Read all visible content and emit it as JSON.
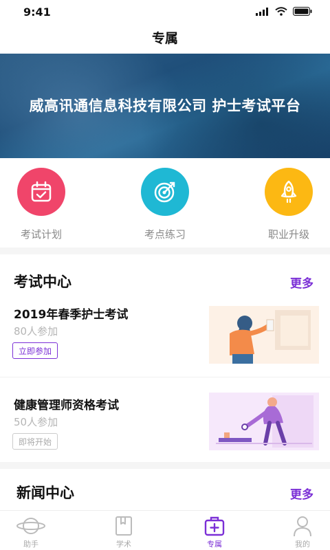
{
  "status": {
    "time": "9:41"
  },
  "nav": {
    "title": "专属"
  },
  "banner": {
    "text": "威高讯通信息科技有限公司 护士考试平台"
  },
  "quick": [
    {
      "label": "考试计划",
      "icon": "calendar-check-icon",
      "color": "#f0456a"
    },
    {
      "label": "考点练习",
      "icon": "target-icon",
      "color": "#1fb8d4"
    },
    {
      "label": "职业升级",
      "icon": "rocket-icon",
      "color": "#fcb813"
    }
  ],
  "exam_center": {
    "title": "考试中心",
    "more": "更多",
    "items": [
      {
        "title": "2019年春季护士考试",
        "count": "80人参加",
        "button": "立即参加",
        "state": "active"
      },
      {
        "title": "健康管理师资格考试",
        "count": "50人参加",
        "button": "即将开始",
        "state": "disabled"
      }
    ]
  },
  "news_center": {
    "title": "新闻中心",
    "more": "更多"
  },
  "tabs": [
    {
      "label": "助手",
      "icon": "planet-icon"
    },
    {
      "label": "学术",
      "icon": "book-icon"
    },
    {
      "label": "专属",
      "icon": "medical-kit-icon",
      "active": true
    },
    {
      "label": "我的",
      "icon": "user-icon"
    }
  ],
  "colors": {
    "accent": "#7b2fd6",
    "banner": "#245a86"
  }
}
